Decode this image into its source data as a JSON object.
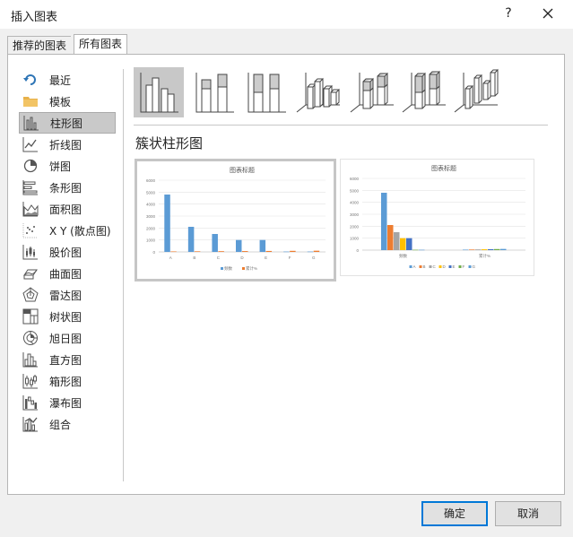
{
  "window": {
    "title": "插入图表",
    "help_label": "?"
  },
  "tabs": [
    {
      "label": "推荐的图表"
    },
    {
      "label": "所有图表"
    }
  ],
  "sidebar": {
    "items": [
      {
        "label": "最近",
        "icon": "recent-icon"
      },
      {
        "label": "模板",
        "icon": "folder-icon"
      },
      {
        "label": "柱形图",
        "icon": "column-chart-icon",
        "selected": true
      },
      {
        "label": "折线图",
        "icon": "line-chart-icon"
      },
      {
        "label": "饼图",
        "icon": "pie-chart-icon"
      },
      {
        "label": "条形图",
        "icon": "bar-chart-icon"
      },
      {
        "label": "面积图",
        "icon": "area-chart-icon"
      },
      {
        "label": "X Y (散点图)",
        "icon": "scatter-chart-icon"
      },
      {
        "label": "股价图",
        "icon": "stock-chart-icon"
      },
      {
        "label": "曲面图",
        "icon": "surface-chart-icon"
      },
      {
        "label": "雷达图",
        "icon": "radar-chart-icon"
      },
      {
        "label": "树状图",
        "icon": "treemap-chart-icon"
      },
      {
        "label": "旭日图",
        "icon": "sunburst-chart-icon"
      },
      {
        "label": "直方图",
        "icon": "histogram-chart-icon"
      },
      {
        "label": "箱形图",
        "icon": "box-whisker-chart-icon"
      },
      {
        "label": "瀑布图",
        "icon": "waterfall-chart-icon"
      },
      {
        "label": "组合",
        "icon": "combo-chart-icon"
      }
    ]
  },
  "subtypes": [
    {
      "icon": "clustered-column-icon",
      "selected": true
    },
    {
      "icon": "stacked-column-icon"
    },
    {
      "icon": "percent-stacked-column-icon"
    },
    {
      "icon": "3d-clustered-column-icon"
    },
    {
      "icon": "3d-stacked-column-icon"
    },
    {
      "icon": "3d-percent-stacked-column-icon"
    },
    {
      "icon": "3d-column-icon"
    }
  ],
  "selected_type_title": "簇状柱形图",
  "colors": {
    "blue": "#5b9bd5",
    "orange": "#ed7d31",
    "gray": "#a5a5a5",
    "yellow": "#ffc000",
    "darkblue": "#4472c4",
    "green": "#70ad47",
    "ok_border": "#0078d7"
  },
  "chart_data": [
    {
      "type": "bar",
      "title": "图表标题",
      "categories": [
        "A",
        "B",
        "C",
        "D",
        "E",
        "F",
        "G"
      ],
      "ylim": [
        0,
        6000
      ],
      "yticks": [
        "0",
        "1000",
        "2000",
        "3000",
        "4000",
        "5000",
        "6000"
      ],
      "grid": true,
      "legend": "bottom",
      "series": [
        {
          "name": "频数",
          "values": [
            4800,
            2100,
            1500,
            1000,
            1000,
            30,
            30
          ]
        },
        {
          "name": "累计%",
          "values": [
            40,
            50,
            60,
            70,
            80,
            90,
            100
          ]
        }
      ]
    },
    {
      "type": "bar",
      "title": "图表标题",
      "categories": [
        "频数",
        "累计%"
      ],
      "ylim": [
        0,
        6000
      ],
      "yticks": [
        "0",
        "1000",
        "2000",
        "3000",
        "4000",
        "5000",
        "6000"
      ],
      "grid": true,
      "legend": "bottom",
      "series": [
        {
          "name": "A",
          "values": [
            4800,
            40
          ]
        },
        {
          "name": "B",
          "values": [
            2100,
            50
          ]
        },
        {
          "name": "C",
          "values": [
            1500,
            60
          ]
        },
        {
          "name": "D",
          "values": [
            1000,
            70
          ]
        },
        {
          "name": "E",
          "values": [
            1000,
            80
          ]
        },
        {
          "name": "F",
          "values": [
            30,
            90
          ]
        },
        {
          "name": "G",
          "values": [
            30,
            100
          ]
        }
      ]
    }
  ],
  "buttons": {
    "ok": "确定",
    "cancel": "取消"
  }
}
